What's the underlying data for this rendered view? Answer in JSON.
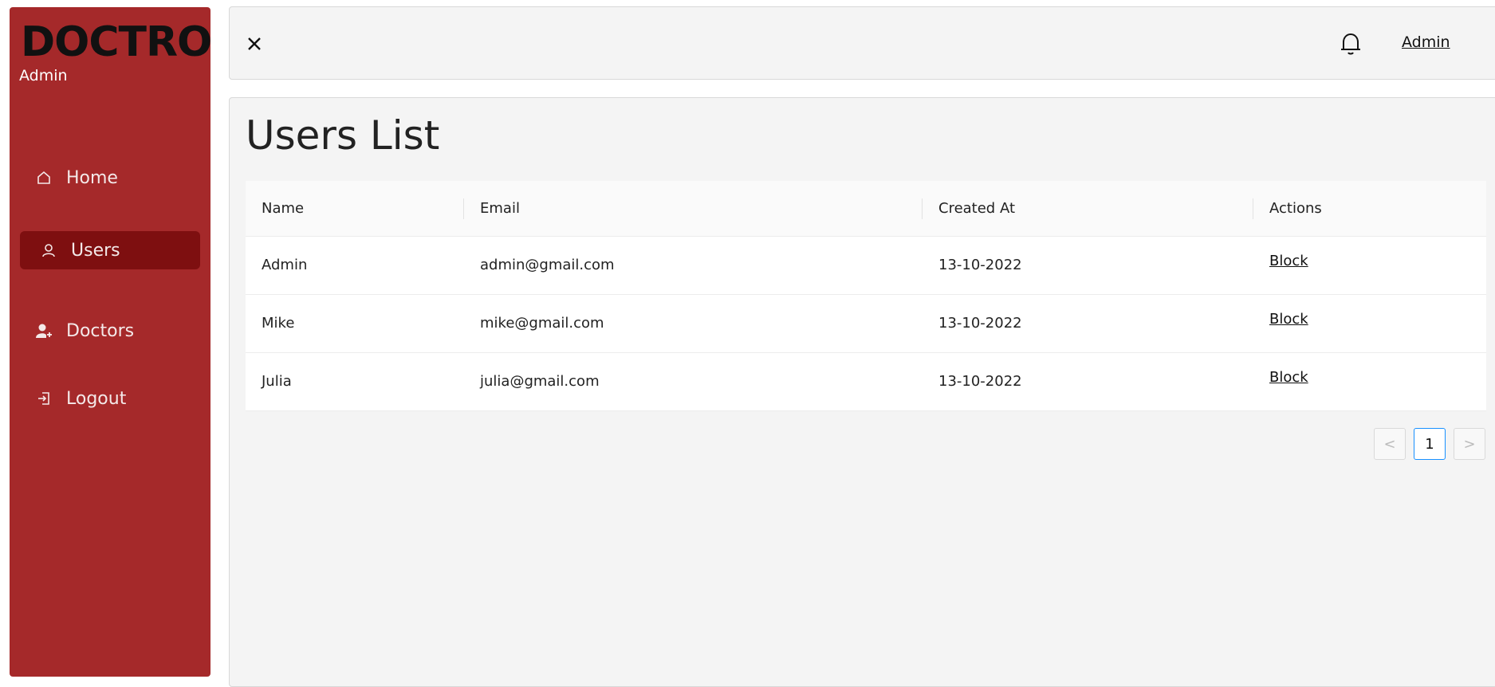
{
  "sidebar": {
    "brand": "DOCTRO",
    "role": "Admin",
    "items": [
      {
        "label": "Home",
        "icon": "home-icon",
        "active": false
      },
      {
        "label": "Users",
        "icon": "user-icon",
        "active": true
      },
      {
        "label": "Doctors",
        "icon": "user-add-icon",
        "active": false
      },
      {
        "label": "Logout",
        "icon": "logout-icon",
        "active": false
      }
    ]
  },
  "header": {
    "close_icon": "close-icon",
    "bell_icon": "bell-icon",
    "user_link": "Admin"
  },
  "main": {
    "title": "Users List",
    "table": {
      "columns": [
        "Name",
        "Email",
        "Created At",
        "Actions"
      ],
      "rows": [
        {
          "name": "Admin",
          "email": "admin@gmail.com",
          "created_at": "13-10-2022",
          "action": "Block"
        },
        {
          "name": "Mike",
          "email": "mike@gmail.com",
          "created_at": "13-10-2022",
          "action": "Block"
        },
        {
          "name": "Julia",
          "email": "julia@gmail.com",
          "created_at": "13-10-2022",
          "action": "Block"
        }
      ]
    },
    "pagination": {
      "prev": "<",
      "current": "1",
      "next": ">"
    }
  },
  "colors": {
    "sidebar_bg": "#a5292a",
    "active_item_bg": "#7e0f10",
    "pager_active_border": "#1890ff"
  }
}
